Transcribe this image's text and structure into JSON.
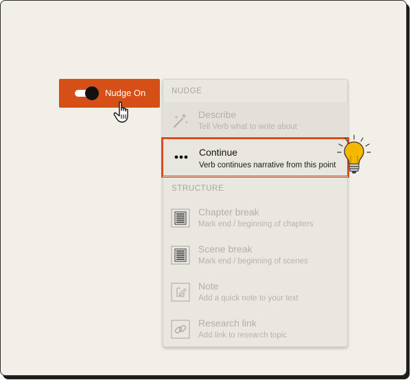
{
  "nudge_button": {
    "label": "Nudge On",
    "toggle_on": true
  },
  "menu": {
    "sections": [
      {
        "heading": "NUDGE",
        "items": [
          {
            "title": "Describe",
            "subtitle": "Tell Verb what to write about",
            "icon": "magic-wand-icon",
            "enabled": false
          },
          {
            "title": "Continue",
            "subtitle": "Verb continues narrative from this point",
            "icon": "ellipsis-icon",
            "enabled": true,
            "highlighted": true
          }
        ]
      },
      {
        "heading": "STRUCTURE",
        "items": [
          {
            "title": "Chapter break",
            "subtitle": "Mark end / beginning of chapters",
            "icon": "document-lines-icon",
            "enabled": false
          },
          {
            "title": "Scene break",
            "subtitle": "Mark end / beginning of scenes",
            "icon": "document-lines-icon",
            "enabled": false
          },
          {
            "title": "Note",
            "subtitle": "Add a quick note to your text",
            "icon": "edit-note-icon",
            "enabled": false
          },
          {
            "title": "Research link",
            "subtitle": "Add link to research topic",
            "icon": "link-icon",
            "enabled": false
          }
        ]
      }
    ]
  },
  "colors": {
    "accent": "#d64f17",
    "background": "#f2efe9",
    "menu_background": "#eae7e1",
    "disabled_text": "#b3afa8",
    "bulb": "#f5b800"
  }
}
